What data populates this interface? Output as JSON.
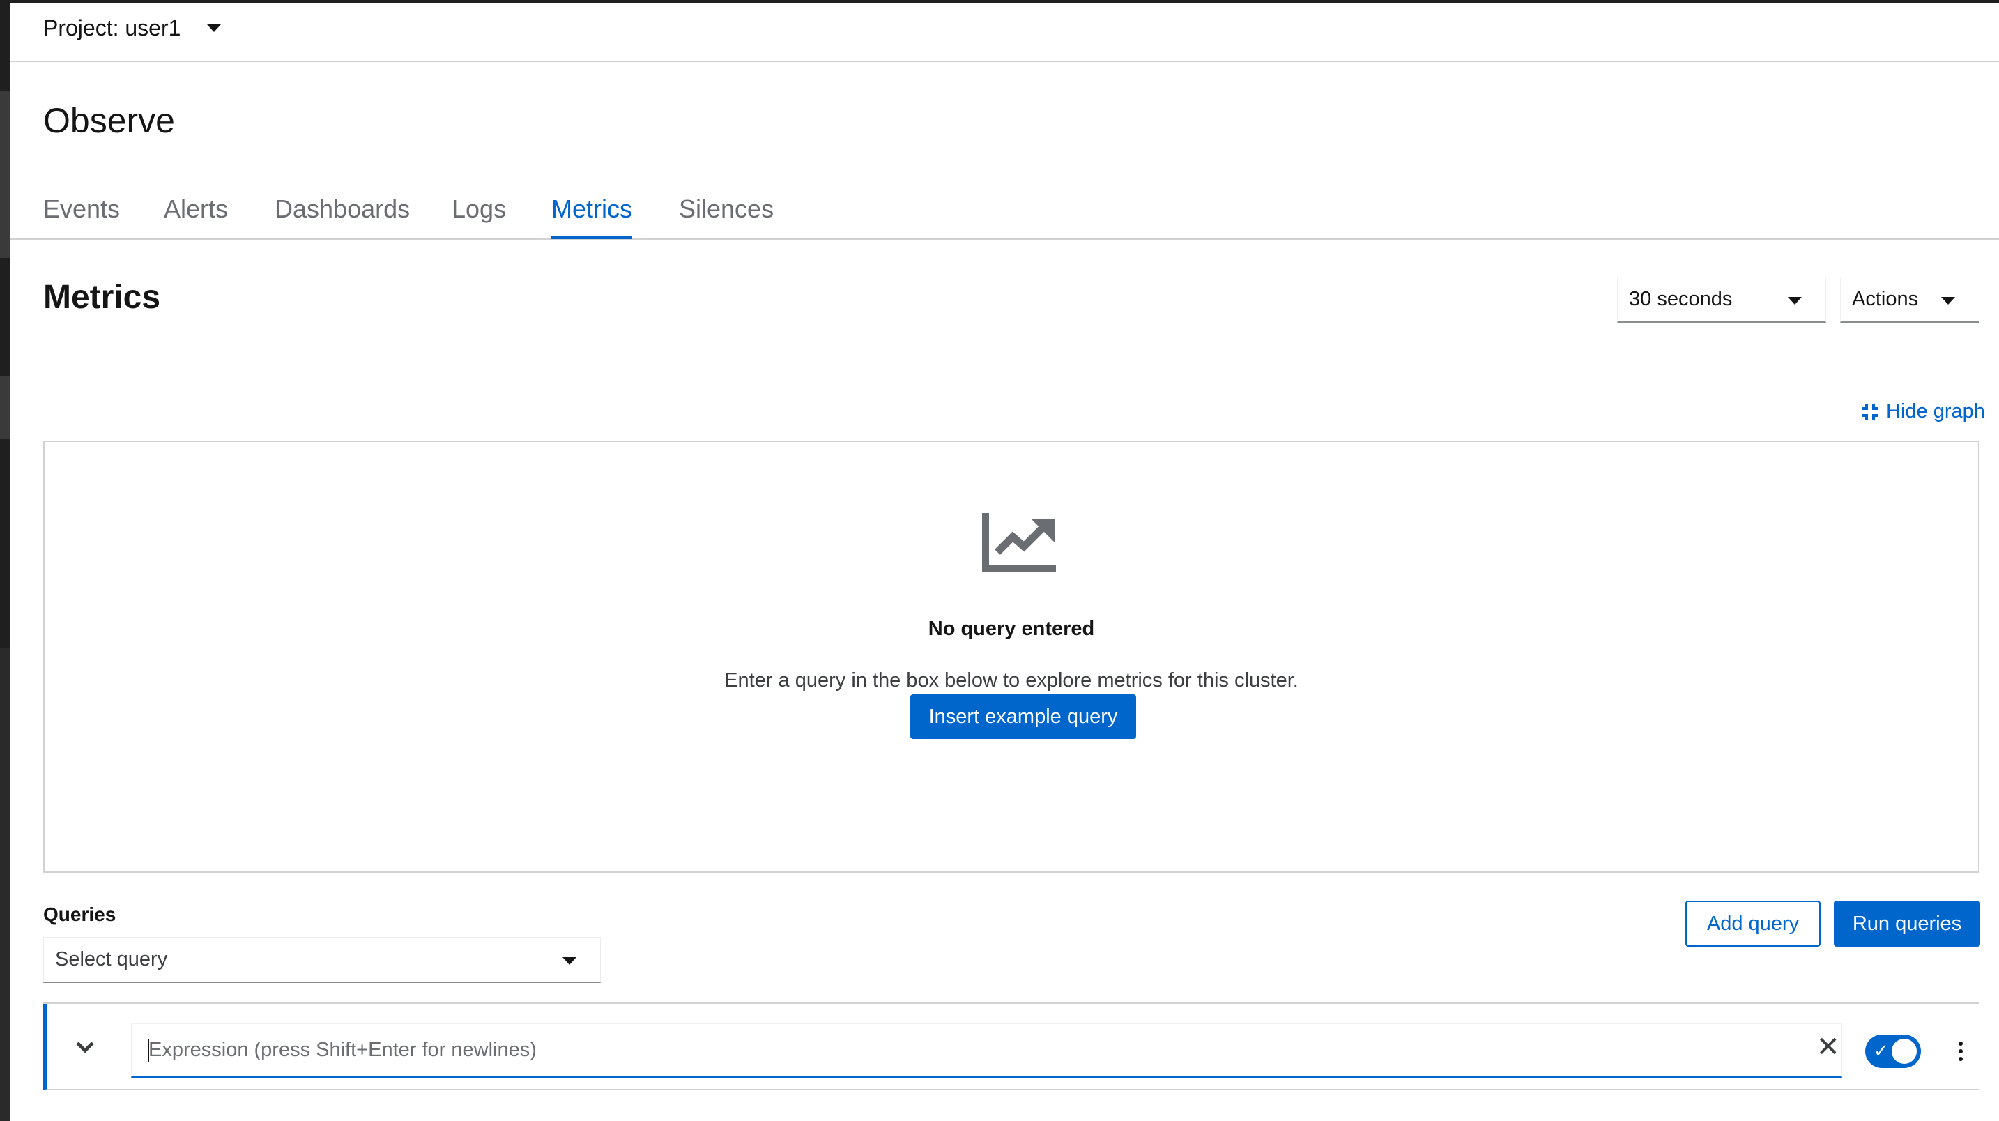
{
  "project": {
    "label": "Project: user1"
  },
  "page": {
    "title": "Observe"
  },
  "tabs": [
    {
      "label": "Events",
      "active": false
    },
    {
      "label": "Alerts",
      "active": false
    },
    {
      "label": "Dashboards",
      "active": false
    },
    {
      "label": "Logs",
      "active": false
    },
    {
      "label": "Metrics",
      "active": true
    },
    {
      "label": "Silences",
      "active": false
    }
  ],
  "metrics": {
    "title": "Metrics",
    "interval_select": "30 seconds",
    "actions_label": "Actions",
    "hide_graph_label": "Hide graph"
  },
  "empty_state": {
    "title": "No query entered",
    "body": "Enter a query in the box below to explore metrics for this cluster.",
    "button": "Insert example query",
    "icon": "chart-area-icon"
  },
  "queries": {
    "label": "Queries",
    "select_placeholder": "Select query",
    "add_button": "Add query",
    "run_button": "Run queries",
    "expression_placeholder": "Expression (press Shift+Enter for newlines)",
    "expression_value": "",
    "enabled": true
  },
  "colors": {
    "accent": "#0066cc",
    "text": "#151515",
    "muted": "#6a6e73",
    "border": "#d2d2d2"
  }
}
